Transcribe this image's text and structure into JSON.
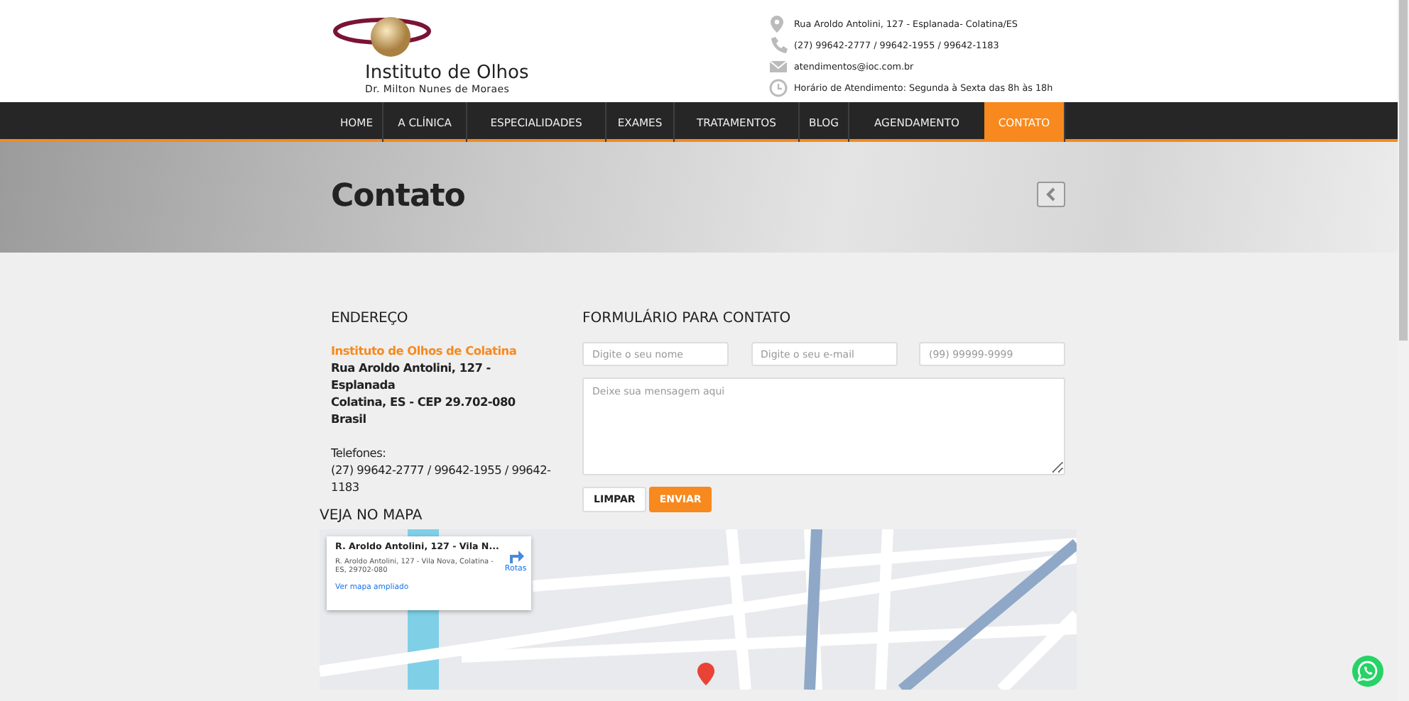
{
  "header": {
    "logo": {
      "title": "Instituto de Olhos",
      "subtitle": "Dr. Milton Nunes de Moraes"
    },
    "contacts": [
      {
        "kind": "pin",
        "text": "Rua Aroldo Antolini, 127 - Esplanada- Colatina/ES"
      },
      {
        "kind": "phone",
        "text": "(27) 99642-2777 / 99642-1955 / 99642-1183"
      },
      {
        "kind": "mail",
        "text": "atendimentos@ioc.com.br"
      },
      {
        "kind": "clock",
        "text": "Horário de Atendimento: Segunda à Sexta das 8h às 18h"
      }
    ]
  },
  "nav": [
    {
      "label": "HOME",
      "selected": false
    },
    {
      "label": "A CLÍNICA",
      "selected": false
    },
    {
      "label": "ESPECIALIDADES",
      "selected": false
    },
    {
      "label": "EXAMES",
      "selected": false
    },
    {
      "label": "TRATAMENTOS",
      "selected": false
    },
    {
      "label": "BLOG",
      "selected": false
    },
    {
      "label": "AGENDAMENTO",
      "selected": false
    },
    {
      "label": "CONTATO",
      "selected": true
    }
  ],
  "banner": {
    "title": "Contato"
  },
  "address": {
    "heading": "ENDEREÇO",
    "name": "Instituto de Olhos de Colatina",
    "lines": [
      "Rua Aroldo Antolini, 127 - Esplanada",
      "Colatina, ES - CEP 29.702-080",
      "Brasil"
    ],
    "phones_label": "Telefones:",
    "phones": "(27) 99642-2777 / 99642-1955 / 99642-1183"
  },
  "form": {
    "heading": "FORMULÁRIO PARA CONTATO",
    "fields": [
      {
        "placeholder": "Digite o seu nome"
      },
      {
        "placeholder": "Digite o seu e-mail"
      },
      {
        "placeholder": "(99) 99999-9999"
      }
    ],
    "message": {
      "placeholder": "Deixe sua mensagem aqui"
    },
    "buttons": [
      {
        "label": "LIMPAR",
        "kind": "secondary"
      },
      {
        "label": "ENVIAR",
        "kind": "primary"
      }
    ]
  },
  "map": {
    "heading": "VEJA NO MAPA",
    "card": {
      "title": "R. Aroldo Antolini, 127 - Vila N...",
      "address": "R. Aroldo Antolini, 127 - Vila Nova, Colatina - ES, 29702-080",
      "link": "Ver mapa ampliado",
      "directions": "Rotas"
    }
  }
}
